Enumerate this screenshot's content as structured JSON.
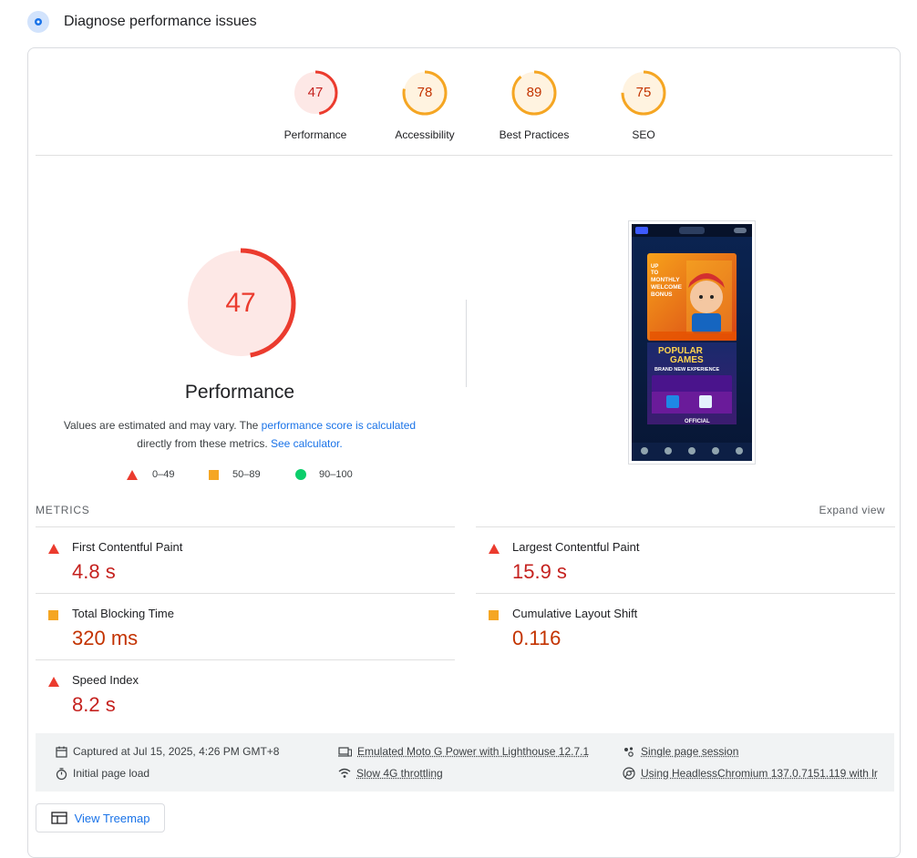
{
  "header": {
    "title": "Diagnose performance issues"
  },
  "categories": [
    {
      "label": "Performance",
      "score": "47",
      "score_fraction": 0.47,
      "color": "#eb3b2e",
      "bg": "#fde8e6"
    },
    {
      "label": "Accessibility",
      "score": "78",
      "score_fraction": 0.78,
      "color": "#f5a623",
      "bg": "#fff3e0"
    },
    {
      "label": "Best Practices",
      "score": "89",
      "score_fraction": 0.89,
      "color": "#f5a623",
      "bg": "#fff3e0"
    },
    {
      "label": "SEO",
      "score": "75",
      "score_fraction": 0.75,
      "color": "#f5a623",
      "bg": "#fff3e0"
    }
  ],
  "main": {
    "score": "47",
    "title": "Performance",
    "note_pre": "Values are estimated and may vary. The ",
    "note_link1": "performance score is calculated",
    "note_mid": "directly from these metrics. ",
    "note_link2": "See calculator."
  },
  "legend": {
    "fail": "0–49",
    "average": "50–89",
    "pass": "90–100"
  },
  "metrics": {
    "label": "METRICS",
    "expand": "Expand view",
    "items": [
      {
        "name": "First Contentful Paint",
        "value": "4.8 s",
        "rating": "fail"
      },
      {
        "name": "Largest Contentful Paint",
        "value": "15.9 s",
        "rating": "fail"
      },
      {
        "name": "Total Blocking Time",
        "value": "320 ms",
        "rating": "average"
      },
      {
        "name": "Cumulative Layout Shift",
        "value": "0.116",
        "rating": "average"
      },
      {
        "name": "Speed Index",
        "value": "8.2 s",
        "rating": "fail"
      }
    ]
  },
  "info": {
    "captured": "Captured at Jul 15, 2025, 4:26 PM GMT+8",
    "load": "Initial page load",
    "device": "Emulated Moto G Power with Lighthouse 12.7.1",
    "throttle": "Slow 4G throttling",
    "session": "Single page session",
    "browser": "Using HeadlessChromium 137.0.7151.119 with lr"
  },
  "screenshot": {
    "banner1_lines": [
      "UP",
      "TO",
      "MONTHLY",
      "WELCOME",
      "BONUS"
    ],
    "banner2_line1": "POPULAR",
    "banner2_line2": "GAMES",
    "banner2_line3": "BRAND NEW EXPERIENCE",
    "footer_text": "OFFICIAL"
  },
  "treemap": {
    "label": "View Treemap"
  },
  "colors": {
    "fail": "#eb3b2e",
    "average": "#f5a623",
    "pass": "#0cce6b",
    "link": "#1a73e8"
  }
}
